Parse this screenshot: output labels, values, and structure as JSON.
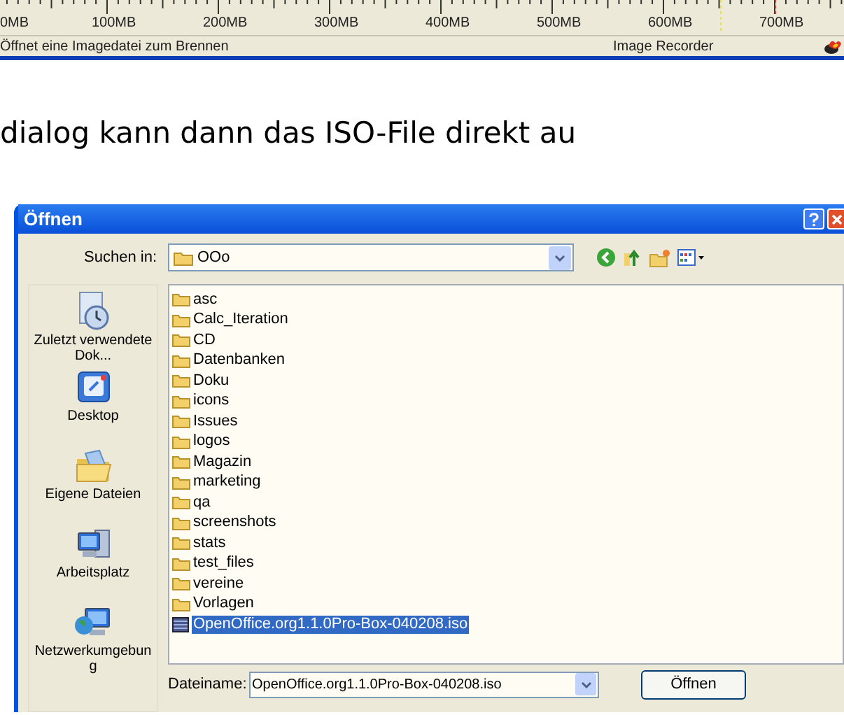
{
  "ruler": {
    "labels": [
      "0MB",
      "100MB",
      "200MB",
      "300MB",
      "400MB",
      "500MB",
      "600MB",
      "700MB"
    ]
  },
  "status_bar": {
    "message": "Öffnet eine Imagedatei zum Brennen",
    "app": "Image Recorder"
  },
  "body_text": "dialog kann dann das ISO-File direkt au",
  "dialog": {
    "title": "Öffnen",
    "look_in": {
      "label": "Suchen in:",
      "value": "OOo"
    },
    "places": [
      {
        "kind": "recent",
        "label": "Zuletzt verwendete Dok..."
      },
      {
        "kind": "desktop",
        "label": "Desktop"
      },
      {
        "kind": "documents",
        "label": "Eigene Dateien"
      },
      {
        "kind": "computer",
        "label": "Arbeitsplatz"
      },
      {
        "kind": "network",
        "label": "Netzwerkumgebung"
      }
    ],
    "files": [
      {
        "kind": "folder",
        "name": "asc",
        "selected": false
      },
      {
        "kind": "folder",
        "name": "Calc_Iteration",
        "selected": false
      },
      {
        "kind": "folder",
        "name": "CD",
        "selected": false
      },
      {
        "kind": "folder",
        "name": "Datenbanken",
        "selected": false
      },
      {
        "kind": "folder",
        "name": "Doku",
        "selected": false
      },
      {
        "kind": "folder",
        "name": "icons",
        "selected": false
      },
      {
        "kind": "folder",
        "name": "Issues",
        "selected": false
      },
      {
        "kind": "folder",
        "name": "logos",
        "selected": false
      },
      {
        "kind": "folder",
        "name": "Magazin",
        "selected": false
      },
      {
        "kind": "folder",
        "name": "marketing",
        "selected": false
      },
      {
        "kind": "folder",
        "name": "qa",
        "selected": false
      },
      {
        "kind": "folder",
        "name": "screenshots",
        "selected": false
      },
      {
        "kind": "folder",
        "name": "stats",
        "selected": false
      },
      {
        "kind": "folder",
        "name": "test_files",
        "selected": false
      },
      {
        "kind": "folder",
        "name": "vereine",
        "selected": false
      },
      {
        "kind": "folder",
        "name": "Vorlagen",
        "selected": false
      },
      {
        "kind": "image",
        "name": "OpenOffice.org1.1.0Pro-Box-040208.iso",
        "selected": true
      }
    ],
    "file_name": {
      "label": "Dateiname:",
      "value": "OpenOffice.org1.1.0Pro-Box-040208.iso"
    },
    "buttons": [
      "Öffnen"
    ]
  }
}
